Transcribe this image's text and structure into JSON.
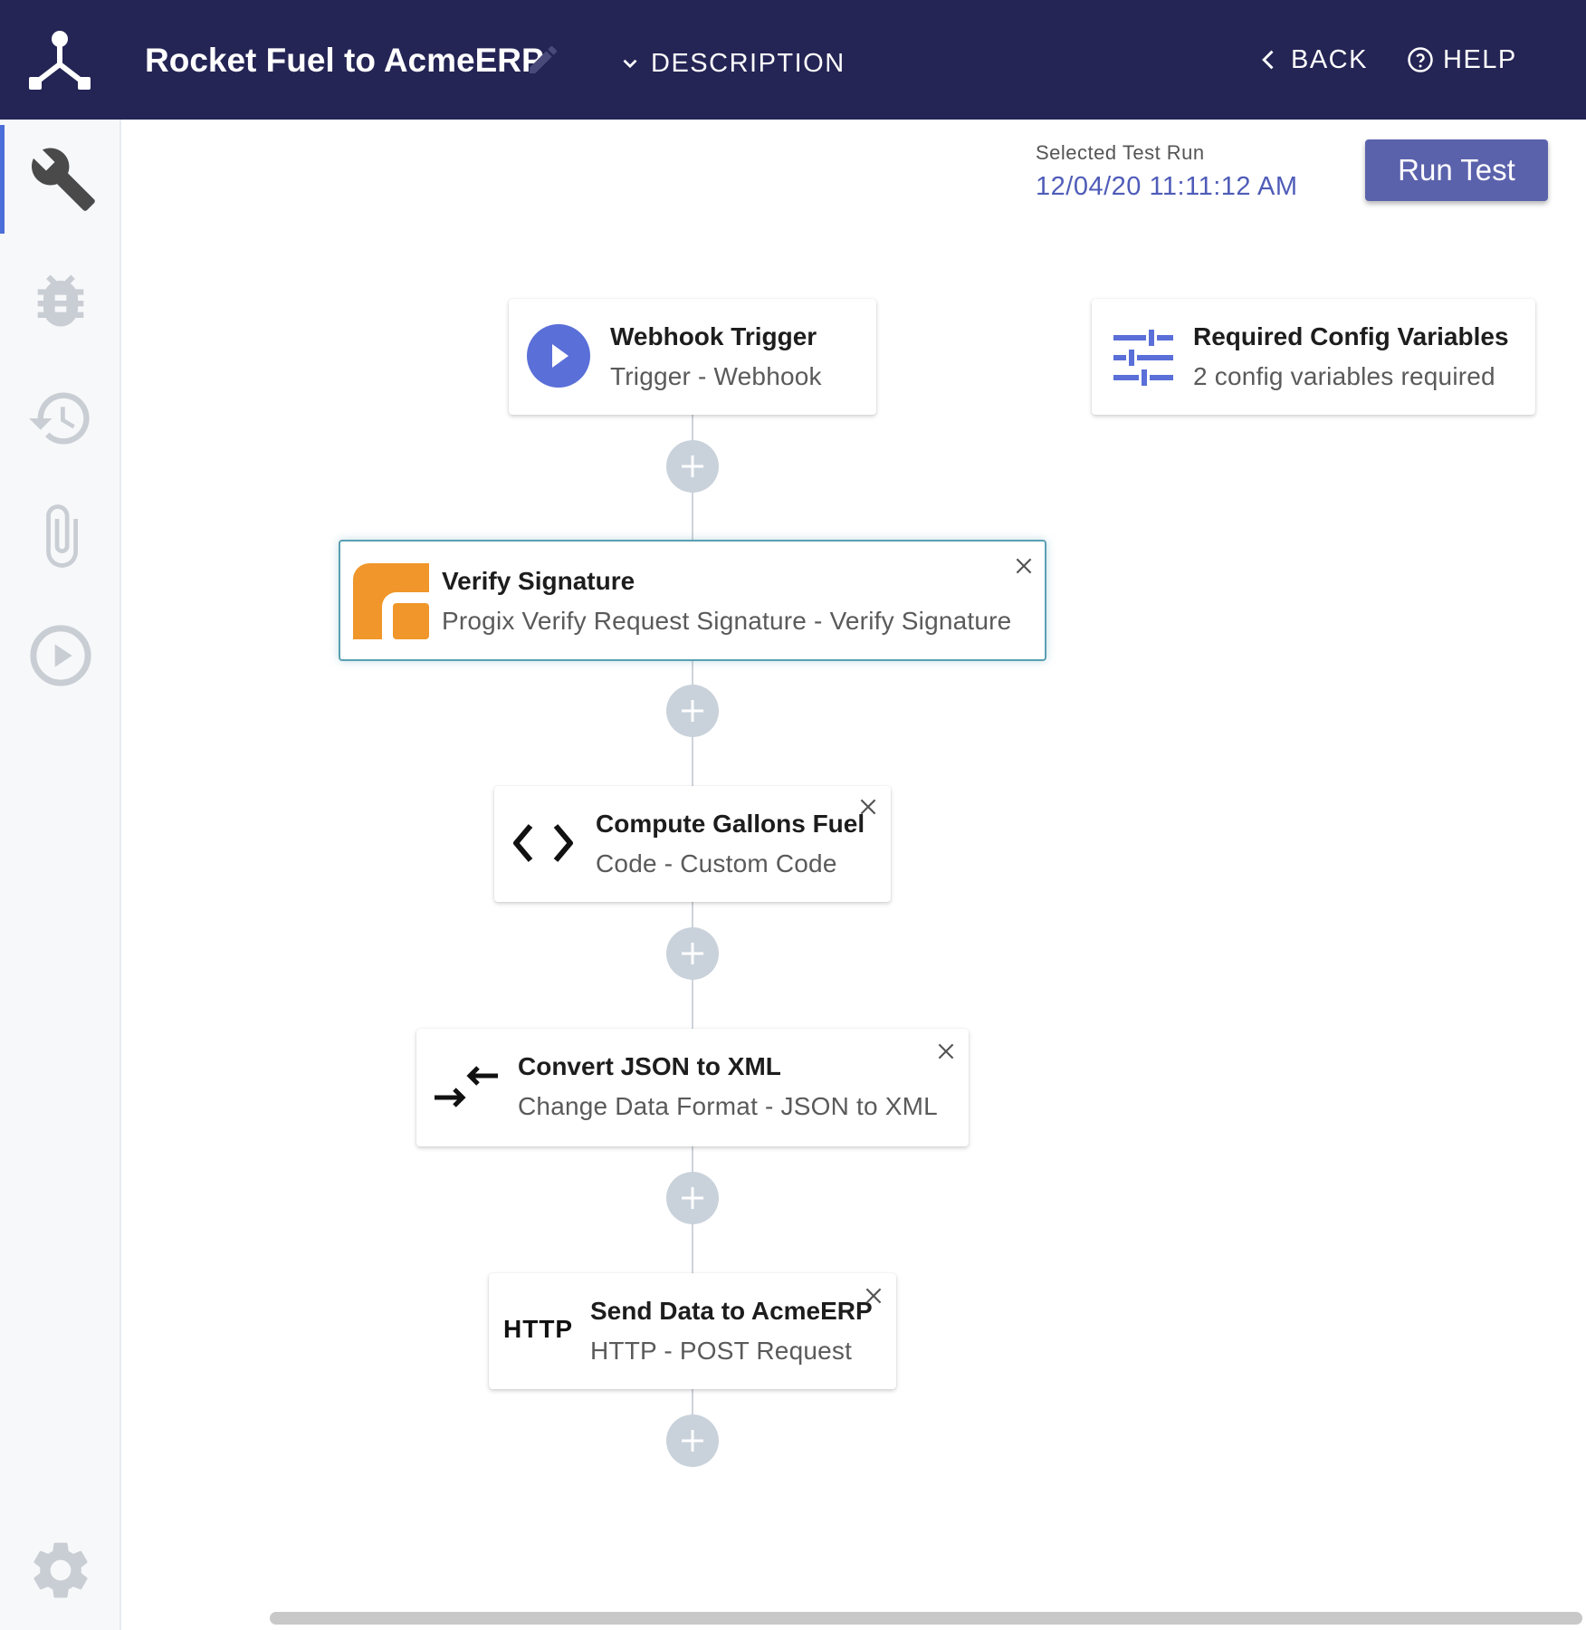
{
  "header": {
    "title": "Rocket Fuel to AcmeERP",
    "description_label": "DESCRIPTION",
    "back_label": "BACK",
    "help_label": "HELP"
  },
  "sidebar": {
    "items": [
      {
        "icon": "wrench-icon",
        "active": true
      },
      {
        "icon": "bug-icon",
        "active": false
      },
      {
        "icon": "history-icon",
        "active": false
      },
      {
        "icon": "paperclip-icon",
        "active": false
      },
      {
        "icon": "play-circle-icon",
        "active": false
      }
    ],
    "footer_icon": "gear-icon"
  },
  "test_run": {
    "label": "Selected Test Run",
    "value": "12/04/20 11:11:12 AM",
    "button_label": "Run Test"
  },
  "trigger": {
    "title": "Webhook Trigger",
    "subtitle": "Trigger - Webhook",
    "icon": "play-icon"
  },
  "config": {
    "title": "Required Config Variables",
    "subtitle": "2 config variables required",
    "icon": "sliders-icon"
  },
  "steps": [
    {
      "title": "Verify Signature",
      "subtitle": "Progix Verify Request Signature - Verify Signature",
      "icon": "progix-logo-icon",
      "selected": true
    },
    {
      "title": "Compute Gallons Fuel",
      "subtitle": "Code - Custom Code",
      "icon": "code-icon",
      "selected": false
    },
    {
      "title": "Convert JSON to XML",
      "subtitle": "Change Data Format - JSON to XML",
      "icon": "swap-arrows-icon",
      "selected": false
    },
    {
      "title": "Send Data to AcmeERP",
      "subtitle": "HTTP - POST Request",
      "icon": "http-icon",
      "icon_text": "HTTP",
      "selected": false
    }
  ],
  "colors": {
    "header_bg": "#242455",
    "accent": "#4c6ed8",
    "run_button": "#5b62ac",
    "progix_orange": "#f0962a"
  }
}
